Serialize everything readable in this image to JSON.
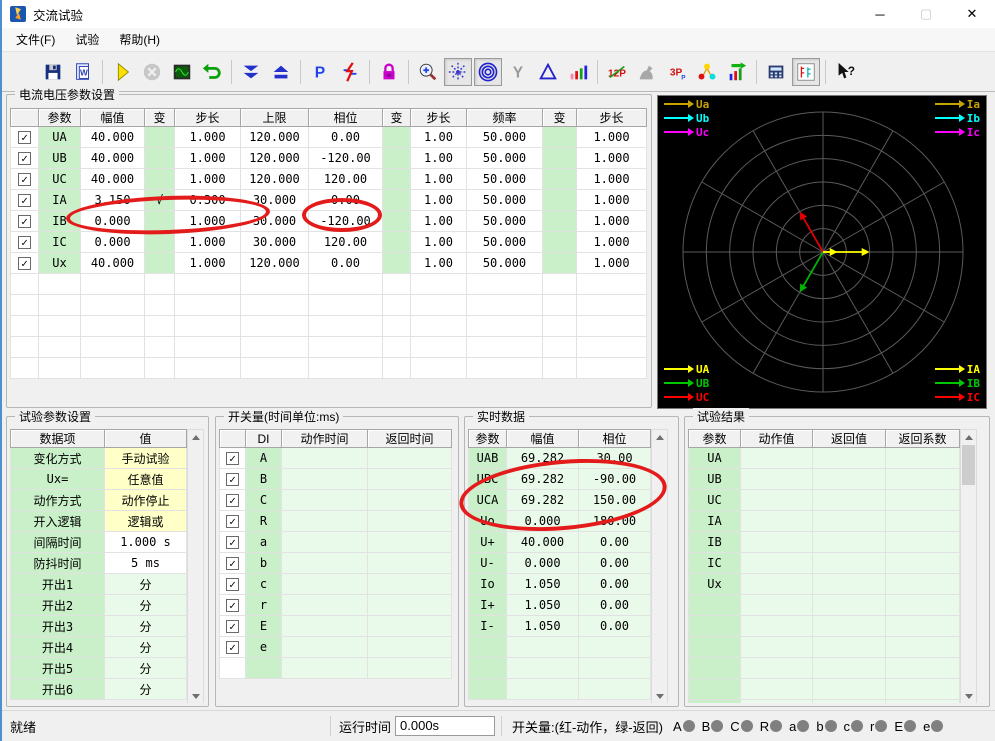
{
  "colors": {
    "cell_green": "#c9f0c9",
    "cell_green_light": "#eafaea",
    "cell_yellow": "#ffffc8",
    "annotation_red": "#e31b1b",
    "indicator_gray": "#808080"
  },
  "window": {
    "title": "交流试验",
    "minimize": "─",
    "maximize": "▢",
    "close": "✕"
  },
  "menu": {
    "items": [
      {
        "label": "文件(F)"
      },
      {
        "label": "试验"
      },
      {
        "label": "帮助(H)"
      }
    ]
  },
  "toolbar": {
    "icons": [
      "open",
      "save",
      "export-report",
      "start",
      "stop",
      "waveform",
      "undo",
      "lower",
      "raise",
      "phase-p",
      "fault",
      "lock",
      "zoom",
      "rays",
      "target",
      "y-connection",
      "triangle",
      "bar-graph",
      "12p",
      "horse",
      "3p",
      "molecule",
      "export-chart",
      "calculator",
      "k-chart",
      "help"
    ],
    "badge_p": "P",
    "badge_y": "Y",
    "badge_12p": "12P",
    "badge_3p": "3P",
    "badge_help": "?"
  },
  "param_group": {
    "title": "电流电压参数设置",
    "headers": [
      "参数",
      "幅值",
      "变",
      "步长",
      "上限",
      "相位",
      "变",
      "步长",
      "频率",
      "变",
      "步长"
    ],
    "rows": [
      {
        "param": "UA",
        "amp": "40.000",
        "var1": "",
        "step1": "1.000",
        "limit": "120.000",
        "phase": "0.00",
        "var2": "",
        "step2": "1.00",
        "freq": "50.000",
        "var3": "",
        "step3": "1.000"
      },
      {
        "param": "UB",
        "amp": "40.000",
        "var1": "",
        "step1": "1.000",
        "limit": "120.000",
        "phase": "-120.00",
        "var2": "",
        "step2": "1.00",
        "freq": "50.000",
        "var3": "",
        "step3": "1.000"
      },
      {
        "param": "UC",
        "amp": "40.000",
        "var1": "",
        "step1": "1.000",
        "limit": "120.000",
        "phase": "120.00",
        "var2": "",
        "step2": "1.00",
        "freq": "50.000",
        "var3": "",
        "step3": "1.000"
      },
      {
        "param": "IA",
        "amp": "3.150",
        "var1": "√",
        "step1": "0.300",
        "limit": "30.000",
        "phase": "0.00",
        "var2": "",
        "step2": "1.00",
        "freq": "50.000",
        "var3": "",
        "step3": "1.000",
        "selected": true
      },
      {
        "param": "IB",
        "amp": "0.000",
        "var1": "",
        "step1": "1.000",
        "limit": "30.000",
        "phase": "-120.00",
        "var2": "",
        "step2": "1.00",
        "freq": "50.000",
        "var3": "",
        "step3": "1.000"
      },
      {
        "param": "IC",
        "amp": "0.000",
        "var1": "",
        "step1": "1.000",
        "limit": "30.000",
        "phase": "120.00",
        "var2": "",
        "step2": "1.00",
        "freq": "50.000",
        "var3": "",
        "step3": "1.000"
      },
      {
        "param": "Ux",
        "amp": "40.000",
        "var1": "",
        "step1": "1.000",
        "limit": "120.000",
        "phase": "0.00",
        "var2": "",
        "step2": "1.00",
        "freq": "50.000",
        "var3": "",
        "step3": "1.000"
      }
    ]
  },
  "test_params_group": {
    "title": "试验参数设置",
    "headers": [
      "数据项",
      "值"
    ],
    "rows": [
      {
        "item": "变化方式",
        "value": "手动试验",
        "vcls": "yellow"
      },
      {
        "item": "Ux=",
        "value": "任意值",
        "vcls": "yellow"
      },
      {
        "item": "动作方式",
        "value": "动作停止",
        "vcls": "yellow"
      },
      {
        "item": "开入逻辑",
        "value": "逻辑或",
        "vcls": "yellow"
      },
      {
        "item": "间隔时间",
        "value": "1.000 s",
        "vcls": "white"
      },
      {
        "item": "防抖时间",
        "value": "5 ms",
        "vcls": "white"
      },
      {
        "item": "开出1",
        "value": "分",
        "vcls": "green"
      },
      {
        "item": "开出2",
        "value": "分",
        "vcls": "green"
      },
      {
        "item": "开出3",
        "value": "分",
        "vcls": "green"
      },
      {
        "item": "开出4",
        "value": "分",
        "vcls": "green"
      },
      {
        "item": "开出5",
        "value": "分",
        "vcls": "green"
      },
      {
        "item": "开出6",
        "value": "分",
        "vcls": "green"
      }
    ]
  },
  "switch_group": {
    "title": "开关量(时间单位:ms)",
    "headers": [
      "DI",
      "动作时间",
      "返回时间"
    ],
    "rows": [
      {
        "di": "A"
      },
      {
        "di": "B"
      },
      {
        "di": "C"
      },
      {
        "di": "R"
      },
      {
        "di": "a"
      },
      {
        "di": "b"
      },
      {
        "di": "c"
      },
      {
        "di": "r"
      },
      {
        "di": "E"
      },
      {
        "di": "e"
      }
    ]
  },
  "realtime_group": {
    "title": "实时数据",
    "headers": [
      "参数",
      "幅值",
      "相位"
    ],
    "rows": [
      {
        "param": "UAB",
        "amp": "69.282",
        "phase": "30.00"
      },
      {
        "param": "UBC",
        "amp": "69.282",
        "phase": "-90.00"
      },
      {
        "param": "UCA",
        "amp": "69.282",
        "phase": "150.00"
      },
      {
        "param": "Uo",
        "amp": "0.000",
        "phase": "180.00"
      },
      {
        "param": "U+",
        "amp": "40.000",
        "phase": "0.00"
      },
      {
        "param": "U-",
        "amp": "0.000",
        "phase": "0.00"
      },
      {
        "param": "Io",
        "amp": "1.050",
        "phase": "0.00"
      },
      {
        "param": "I+",
        "amp": "1.050",
        "phase": "0.00"
      },
      {
        "param": "I-",
        "amp": "1.050",
        "phase": "0.00"
      }
    ]
  },
  "result_group": {
    "title": "试验结果",
    "headers": [
      "参数",
      "动作值",
      "返回值",
      "返回系数"
    ],
    "rows": [
      {
        "param": "UA"
      },
      {
        "param": "UB"
      },
      {
        "param": "UC"
      },
      {
        "param": "IA"
      },
      {
        "param": "IB"
      },
      {
        "param": "IC"
      },
      {
        "param": "Ux"
      }
    ]
  },
  "phasor_panel": {
    "bg": "#000000",
    "grid_color": "#5a5a5a",
    "rings": 6,
    "spokes": 12,
    "vectors": [
      {
        "name": "UA",
        "color": "#ffff00",
        "angle_deg": 0,
        "mag": 40,
        "full_scale": 120
      },
      {
        "name": "UB",
        "color": "#00b400",
        "angle_deg": -120,
        "mag": 40,
        "full_scale": 120
      },
      {
        "name": "UC",
        "color": "#e00000",
        "angle_deg": 120,
        "mag": 40,
        "full_scale": 120
      },
      {
        "name": "IA",
        "color": "#ffff00",
        "angle_deg": 0,
        "mag": 3.15,
        "full_scale": 30
      }
    ],
    "legend_top_left": [
      {
        "label": "Ua",
        "color": "#c8a400"
      },
      {
        "label": "Ub",
        "color": "#00ffff"
      },
      {
        "label": "Uc",
        "color": "#ff00ff"
      }
    ],
    "legend_top_right": [
      {
        "label": "Ia",
        "color": "#c8a400"
      },
      {
        "label": "Ib",
        "color": "#00ffff"
      },
      {
        "label": "Ic",
        "color": "#ff00ff"
      }
    ],
    "legend_bottom_left": [
      {
        "label": "UA",
        "color": "#ffff00"
      },
      {
        "label": "UB",
        "color": "#00c800"
      },
      {
        "label": "UC",
        "color": "#ff0000"
      }
    ],
    "legend_bottom_right": [
      {
        "label": "IA",
        "color": "#ffff00"
      },
      {
        "label": "IB",
        "color": "#00c800"
      },
      {
        "label": "IC",
        "color": "#ff0000"
      }
    ]
  },
  "statusbar": {
    "ready": "就绪",
    "runtime_label": "运行时间",
    "runtime_value": "0.000s",
    "switch_label": "开关量:(红-动作，绿-返回)",
    "indicators": [
      {
        "label": "A"
      },
      {
        "label": "B"
      },
      {
        "label": "C"
      },
      {
        "label": "R"
      },
      {
        "label": "a"
      },
      {
        "label": "b"
      },
      {
        "label": "c"
      },
      {
        "label": "r"
      },
      {
        "label": "E"
      },
      {
        "label": "e"
      }
    ]
  }
}
